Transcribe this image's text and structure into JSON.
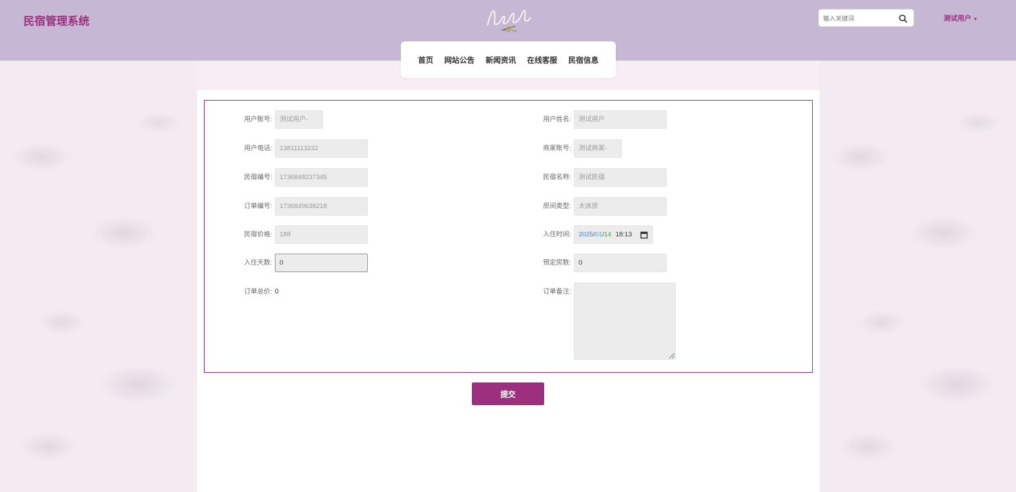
{
  "header": {
    "site_title": "民宿管理系统",
    "search": {
      "placeholder": "输入关键词",
      "icon": "search-icon"
    },
    "user": {
      "name": "测试用户",
      "caret": "▾"
    }
  },
  "nav": {
    "items": [
      {
        "label": "首页"
      },
      {
        "label": "网站公告"
      },
      {
        "label": "新闻资讯"
      },
      {
        "label": "在线客服"
      },
      {
        "label": "民宿信息"
      }
    ]
  },
  "form": {
    "user_account": {
      "label": "用户账号:",
      "value": "测试用户-"
    },
    "user_name": {
      "label": "用户姓名:",
      "value": "测试用户"
    },
    "user_phone": {
      "label": "用户电话:",
      "value": "13811113232"
    },
    "merchant_account": {
      "label": "商家账号:",
      "value": "测试商家-"
    },
    "homestay_no": {
      "label": "民宿编号:",
      "value": "1736848237345"
    },
    "homestay_name": {
      "label": "民宿名称:",
      "value": "测试民宿"
    },
    "order_no": {
      "label": "订单编号:",
      "value": "1736849638218"
    },
    "room_type": {
      "label": "房间类型:",
      "value": "大床房"
    },
    "price": {
      "label": "民宿价格:",
      "value": "188"
    },
    "checkin_time": {
      "label": "入住时间:",
      "year": "2025",
      "month": "01",
      "day": "14",
      "time": "18:13"
    },
    "days": {
      "label": "入住天数:",
      "value": "0"
    },
    "rooms": {
      "label": "预定房数:",
      "value": "0"
    },
    "total": {
      "label": "订单总价:",
      "value": "0"
    },
    "remark": {
      "label": "订单备注:",
      "value": ""
    },
    "submit_label": "提交"
  },
  "colors": {
    "brand": "#9c2f7e",
    "header_bg": "#c6b8d4"
  }
}
